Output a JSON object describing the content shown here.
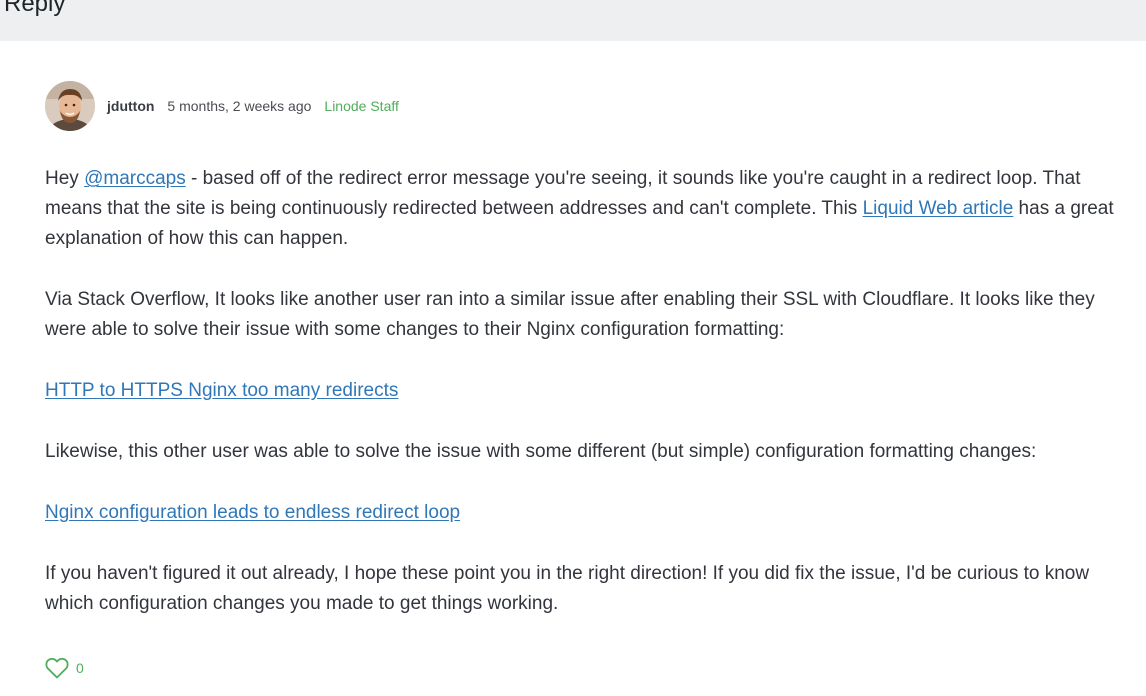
{
  "reply_bar": {
    "title": "Reply"
  },
  "comment": {
    "author": "jdutton",
    "timestamp": "5 months, 2 weeks ago",
    "badge": "Linode Staff",
    "avatar_icon": "user-avatar-photo",
    "paragraphs": {
      "p1": {
        "before_mention": "Hey ",
        "mention": "@marccaps",
        "after_mention": " - based off of the redirect error message you're seeing, it sounds like you're caught in a redirect loop. That means that the site is being continuously redirected between addresses and can't complete. This ",
        "link": "Liquid Web article",
        "after_link": " has a great explanation of how this can happen."
      },
      "p2": "Via Stack Overflow, It looks like another user ran into a similar issue after enabling their SSL with Cloudflare. It looks like they were able to solve their issue with some changes to their Nginx configuration formatting:",
      "p3_link": "HTTP to HTTPS Nginx too many redirects",
      "p4": "Likewise, this other user was able to solve the issue with some different (but simple) configuration formatting changes:",
      "p5_link": "Nginx configuration leads to endless redirect loop",
      "p6": "If you haven't figured it out already, I hope these point you in the right direction! If you did fix the issue, I'd be curious to know which configuration changes you made to get things working."
    },
    "likes": {
      "icon": "heart-icon",
      "count": "0"
    }
  },
  "colors": {
    "link": "#2f77b8",
    "staff_badge": "#4fae5b",
    "reply_bar_bg": "#edeff0"
  }
}
